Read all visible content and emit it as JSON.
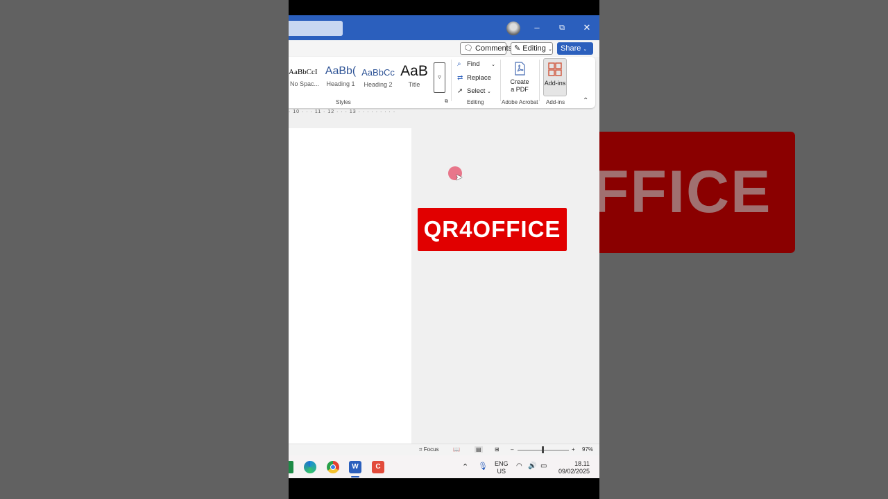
{
  "background": {
    "right_banner_text": "FFICE"
  },
  "window": {
    "controls": {
      "minimize": "–",
      "restore": "⧉",
      "close": "✕"
    }
  },
  "command_bar": {
    "comments_label": "Comments",
    "editing_label": "Editing",
    "share_label": "Share"
  },
  "ribbon": {
    "styles": [
      {
        "sample": "AaBbCcI",
        "name": "No Spac..."
      },
      {
        "sample": "AaBb(",
        "name": "Heading 1"
      },
      {
        "sample": "AaBbCc",
        "name": "Heading 2"
      },
      {
        "sample": "AaB",
        "name": "Title"
      }
    ],
    "styles_group_label": "Styles",
    "editing": {
      "find": "Find",
      "replace": "Replace",
      "select": "Select",
      "group_label": "Editing"
    },
    "acrobat": {
      "button_label_1": "Create",
      "button_label_2": "a PDF",
      "group_label": "Adobe Acrobat"
    },
    "addins": {
      "button_label": "Add-ins",
      "group_label": "Add-ins"
    }
  },
  "ruler": {
    "marks": "· 10 · · · 11 · 12 · · · 13 · · · · · · · · ·"
  },
  "logo": {
    "text": "QR4OFFICE",
    "color": "#e10000"
  },
  "status_bar": {
    "focus_label": "Focus",
    "zoom_minus": "–",
    "zoom_plus": "+",
    "zoom_level": "97%"
  },
  "taskbar": {
    "language": "ENG",
    "region": "US",
    "time": "18.11",
    "date": "09/02/2025"
  },
  "colors": {
    "titlebar": "#2b5fbd",
    "accent": "#2b5fbd"
  }
}
